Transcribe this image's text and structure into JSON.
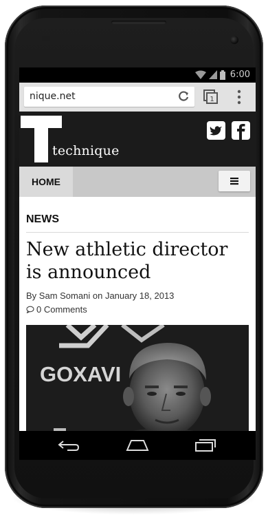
{
  "status_bar": {
    "time": "6:00"
  },
  "browser": {
    "url": "nique.net",
    "tab_count": "1"
  },
  "site": {
    "logo_letter": "T",
    "logo_word": "technique"
  },
  "nav": {
    "home_label": "HOME"
  },
  "article": {
    "section": "NEWS",
    "headline": "New athletic director is announced",
    "by_prefix": "By",
    "author": "Sam Somani",
    "date_prefix": "on",
    "date": "January 18, 2013",
    "comments": "0 Comments",
    "image_text": "GOXAVI"
  },
  "icons": {
    "wifi": "wifi-icon",
    "signal": "signal-icon",
    "battery": "battery-icon",
    "reload": "reload-icon",
    "tabs": "tabs-icon",
    "menu": "overflow-menu-icon",
    "twitter": "twitter-icon",
    "facebook": "facebook-icon",
    "hamburger": "hamburger-icon",
    "comment": "comment-icon",
    "back": "back-icon",
    "home": "home-icon",
    "recents": "recents-icon"
  },
  "colors": {
    "header_bg": "#1b1b1b",
    "nav_bg": "#c8c8c8",
    "nav_active": "#dadada"
  }
}
